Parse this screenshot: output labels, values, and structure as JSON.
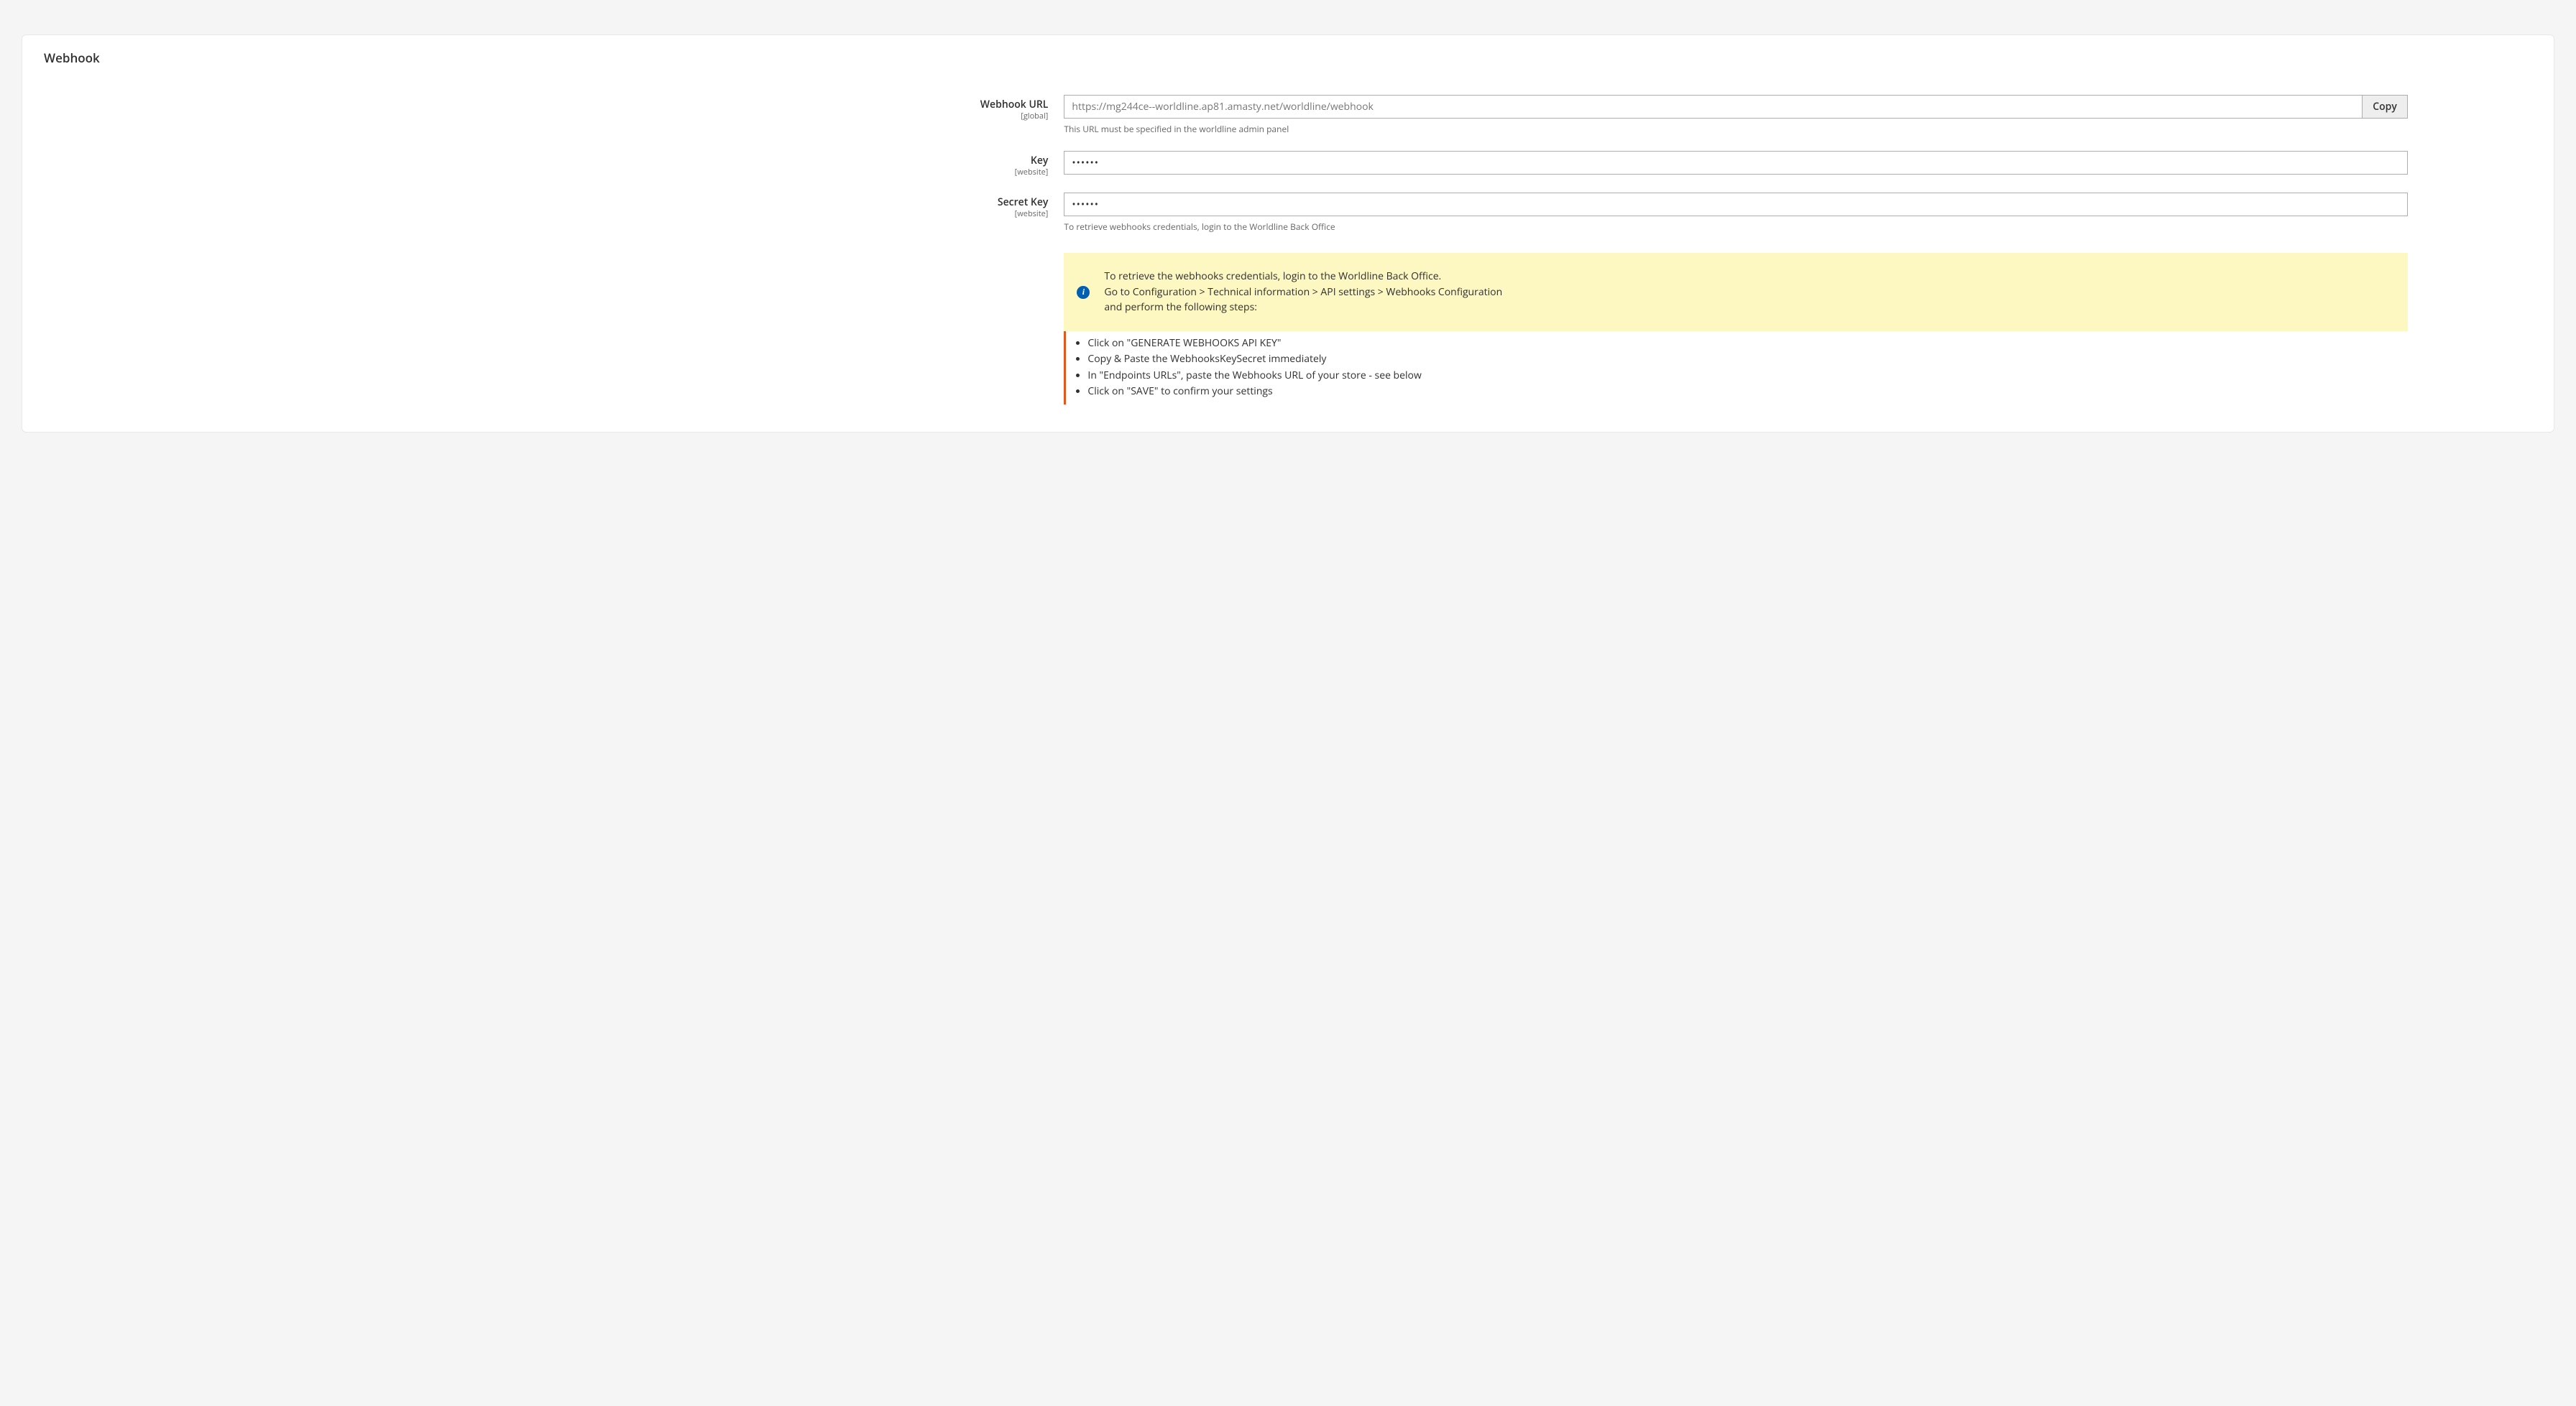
{
  "section": {
    "title": "Webhook"
  },
  "fields": {
    "webhook_url": {
      "label": "Webhook URL",
      "scope": "[global]",
      "value": "https://mg244ce--worldline.ap81.amasty.net/worldline/webhook",
      "copy_label": "Copy",
      "note": "This URL must be specified in the worldline admin panel"
    },
    "key": {
      "label": "Key",
      "scope": "[website]",
      "value": "••••••"
    },
    "secret_key": {
      "label": "Secret Key",
      "scope": "[website]",
      "value": "••••••",
      "note": "To retrieve webhooks credentials, login to the Worldline Back Office"
    }
  },
  "info": {
    "line1": "To retrieve the webhooks credentials, login to the Worldline Back Office.",
    "line2": "Go to Configuration > Technical information > API settings > Webhooks Configuration",
    "line3": "and perform the following steps:"
  },
  "steps": [
    "Click on \"GENERATE WEBHOOKS API KEY\"",
    "Copy & Paste the WebhooksKeySecret immediately",
    "In \"Endpoints URLs\", paste the Webhooks URL of your store - see below",
    "Click on \"SAVE\" to confirm your settings"
  ]
}
